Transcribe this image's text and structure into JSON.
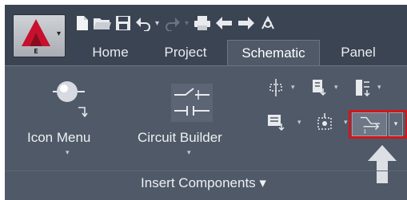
{
  "app_button": {
    "letter": "E",
    "arrow": "▾"
  },
  "quick_access": {
    "items": [
      "new-icon",
      "open-icon",
      "save-icon",
      "undo-icon",
      "redo-icon",
      "print-icon",
      "back-icon",
      "forward-icon",
      "project-manager-icon"
    ],
    "dropdown_glyph": "▾"
  },
  "tabs": [
    {
      "label": "Home"
    },
    {
      "label": "Project"
    },
    {
      "label": "Schematic",
      "active": true
    },
    {
      "label": "Panel"
    }
  ],
  "ribbon": {
    "icon_menu": {
      "label": "Icon Menu",
      "arrow": "▾"
    },
    "circuit_builder": {
      "label": "Circuit Builder",
      "arrow": "▾"
    },
    "small_dropdown_glyph": "▾",
    "panel_title": "Insert Components ▾"
  },
  "colors": {
    "highlight": "#d4141b",
    "ribbon_bg": "#4f5968",
    "titlebar_bg": "#3b4453"
  }
}
